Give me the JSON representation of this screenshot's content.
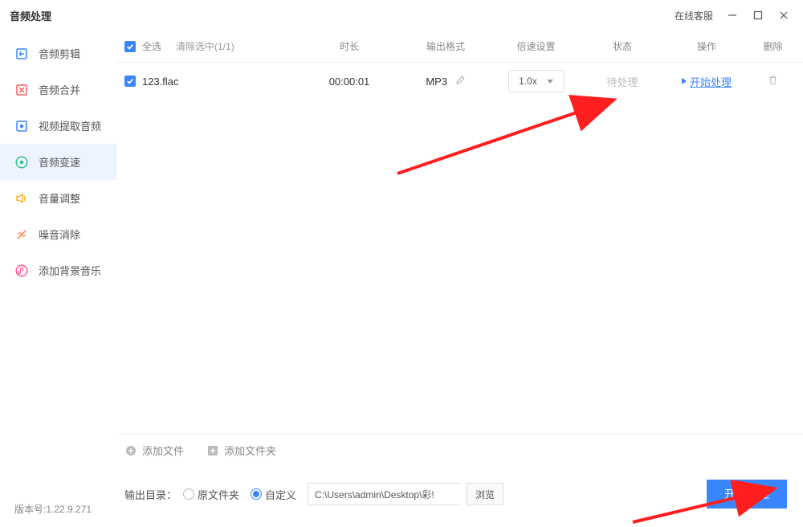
{
  "titlebar": {
    "title": "音频处理",
    "online_service": "在线客服"
  },
  "sidebar": {
    "items": [
      {
        "label": "音频剪辑",
        "icon": "scissors",
        "color": "#3a86ff"
      },
      {
        "label": "音频合并",
        "icon": "merge",
        "color": "#ff5a5a"
      },
      {
        "label": "视频提取音频",
        "icon": "extract",
        "color": "#3a86ff"
      },
      {
        "label": "音频变速",
        "icon": "speed",
        "color": "#2fbf86",
        "active": true
      },
      {
        "label": "音量调整",
        "icon": "volume",
        "color": "#ffb02e"
      },
      {
        "label": "噪音消除",
        "icon": "noise",
        "color": "#ff7a45"
      },
      {
        "label": "添加背景音乐",
        "icon": "bgm",
        "color": "#ff5a8c"
      }
    ]
  },
  "table": {
    "headers": {
      "select_all": "全选",
      "clear_selected": "清除选中(1/1)",
      "duration": "时长",
      "format": "输出格式",
      "speed": "倍速设置",
      "status": "状态",
      "action": "操作",
      "delete": "删除"
    },
    "rows": [
      {
        "filename": "123.flac",
        "duration": "00:00:01",
        "format": "MP3",
        "speed": "1.0x",
        "status": "待处理",
        "action": "开始处理"
      }
    ]
  },
  "bottom_tools": {
    "add_file": "添加文件",
    "add_folder": "添加文件夹"
  },
  "output": {
    "label": "输出目录：",
    "original": "原文件夹",
    "custom": "自定义",
    "path": "C:\\Users\\admin\\Desktop\\彩!",
    "browse": "浏览",
    "start": "开始处理"
  },
  "version": "版本号:1.22.9.271"
}
